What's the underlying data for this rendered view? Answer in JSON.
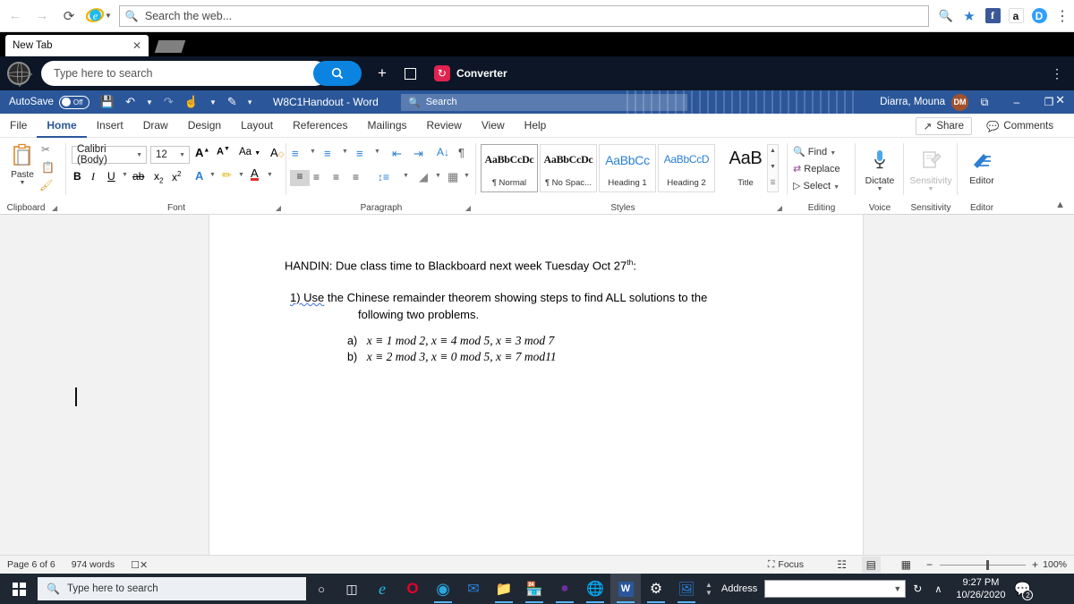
{
  "browser": {
    "nav": {
      "back": "back-arrow",
      "forward": "forward-arrow",
      "refresh": "refresh",
      "logo": "ie-logo"
    },
    "address_placeholder": "Search the web...",
    "right_icons": [
      {
        "name": "zoom-out-icon",
        "glyph": "⌕"
      },
      {
        "name": "favorites-star-icon",
        "glyph": "★"
      },
      {
        "name": "facebook-icon",
        "glyph": "f",
        "color": "#3b5998"
      },
      {
        "name": "amazon-icon",
        "glyph": "a",
        "color": "#ffffff"
      },
      {
        "name": "disqus-icon",
        "glyph": "D",
        "color": "#2e9fff"
      },
      {
        "name": "browser-menu-icon",
        "glyph": "⋮"
      }
    ],
    "tab_title": "New Tab",
    "tab_close": "✕",
    "toolbar": {
      "search_placeholder": "Type here to search",
      "search_button": "🔍",
      "plus": "+",
      "converter_label": "Converter"
    }
  },
  "word": {
    "titlebar": {
      "autosave_label": "AutoSave",
      "autosave_state": "Off",
      "quick_access": [
        "save-icon",
        "undo-icon",
        "redo-icon",
        "touch-icon",
        "customize-icon",
        "more-icon"
      ],
      "document_title": "W8C1Handout  -  Word",
      "search_placeholder": "Search",
      "user_name": "Diarra, Mouna",
      "user_initials": "DM",
      "ribbon_display_icon": "⧉",
      "minimize": "–",
      "restore": "❐",
      "close": "✕"
    },
    "tabs": [
      {
        "label": "File",
        "selected": false
      },
      {
        "label": "Home",
        "selected": true
      },
      {
        "label": "Insert",
        "selected": false
      },
      {
        "label": "Draw",
        "selected": false
      },
      {
        "label": "Design",
        "selected": false
      },
      {
        "label": "Layout",
        "selected": false
      },
      {
        "label": "References",
        "selected": false
      },
      {
        "label": "Mailings",
        "selected": false
      },
      {
        "label": "Review",
        "selected": false
      },
      {
        "label": "View",
        "selected": false
      },
      {
        "label": "Help",
        "selected": false
      }
    ],
    "share_label": "Share",
    "comments_label": "Comments",
    "ribbon": {
      "clipboard": {
        "title": "Clipboard",
        "paste_label": "Paste"
      },
      "font": {
        "title": "Font",
        "font_name": "Calibri (Body)",
        "font_size": "12",
        "grow": "A",
        "shrink": "A",
        "change_case": "Aa",
        "clear_format": "A",
        "bold": "B",
        "italic": "I",
        "underline": "U",
        "strike": "ab",
        "subscript": "x",
        "superscript": "x",
        "text_effects": "A",
        "highlight": "A",
        "font_color": "A"
      },
      "paragraph": {
        "title": "Paragraph"
      },
      "styles": {
        "title": "Styles",
        "items": [
          {
            "preview": "AaBbCcDc",
            "name": "¶ Normal",
            "selected": true
          },
          {
            "preview": "AaBbCcDc",
            "name": "¶ No Spac...",
            "selected": false
          },
          {
            "preview": "AaBbCс",
            "name": "Heading 1",
            "selected": false
          },
          {
            "preview": "AaBbCcD",
            "name": "Heading 2",
            "selected": false
          },
          {
            "preview": "AaB",
            "name": "Title",
            "selected": false
          }
        ]
      },
      "editing": {
        "title": "Editing",
        "find": "Find",
        "replace": "Replace",
        "select": "Select"
      },
      "voice": {
        "title": "Voice",
        "dictate": "Dictate"
      },
      "sensitivity": {
        "title": "Sensitivity",
        "label": "Sensitivity"
      },
      "editor": {
        "title": "Editor",
        "label": "Editor"
      }
    },
    "document": {
      "heading": "HANDIN:  Due class time to Blackboard next week Tuesday Oct 27",
      "heading_sup": "th",
      "heading_end": ":",
      "q1_num": "1)  Use",
      "q1_text": " the Chinese remainder theorem showing steps  to find ALL solutions to the",
      "q1_text2": "following two problems.",
      "item_a_label": "a)",
      "item_a_math": "x ≡ 1 mod 2,   x ≡ 4 mod 5,   x ≡ 3 mod 7",
      "item_b_label": "b)",
      "item_b_math": "x ≡ 2 mod 3,   x ≡ 0 mod 5,   x ≡ 7 mod11"
    },
    "status": {
      "page": "Page 6 of 6",
      "words": "974 words",
      "proofing_icon": "proofing-errors-icon",
      "focus": "Focus",
      "view_read": "read-mode-icon",
      "view_print": "print-layout-icon",
      "view_web": "web-layout-icon",
      "zoom_out": "−",
      "zoom_in": "+",
      "zoom_level": "100%"
    }
  },
  "taskbar": {
    "start": "windows-start",
    "search_placeholder": "Type here to search",
    "cortana": "○",
    "taskview": "task-view",
    "apps": [
      {
        "name": "internet-explorer-icon",
        "glyph": "e",
        "color": "#1ebbee",
        "running": false
      },
      {
        "name": "opera-icon",
        "glyph": "O",
        "color": "#e8002a",
        "running": false
      },
      {
        "name": "microsoft-edge-icon",
        "glyph": "e",
        "color": "#1b9de2",
        "running": true
      },
      {
        "name": "mail-icon",
        "glyph": "✉",
        "color": "#2a7fd4",
        "running": false
      },
      {
        "name": "file-explorer-icon",
        "glyph": "🗀",
        "color": "#ffc340",
        "running": true
      },
      {
        "name": "microsoft-store-icon",
        "glyph": "⊞",
        "color": "#ffffff",
        "running": true
      },
      {
        "name": "purple-app-icon",
        "glyph": "◕",
        "color": "#6b2fa0",
        "running": true
      },
      {
        "name": "globe-app-icon",
        "glyph": "♁",
        "color": "#d8d8d8",
        "running": true
      },
      {
        "name": "word-icon",
        "glyph": "W",
        "color": "#2b579a",
        "running": true,
        "active": true
      },
      {
        "name": "settings-icon",
        "glyph": "⚙",
        "color": "#ffffff",
        "running": true
      },
      {
        "name": "photos-icon",
        "glyph": "🏔",
        "color": "#2a7fd4",
        "running": true
      }
    ],
    "address_label": "Address",
    "address_value": "",
    "refresh_icon": "↻",
    "show_hidden": "∧",
    "time": "9:27 PM",
    "date": "10/26/2020",
    "notification_count": "2"
  }
}
